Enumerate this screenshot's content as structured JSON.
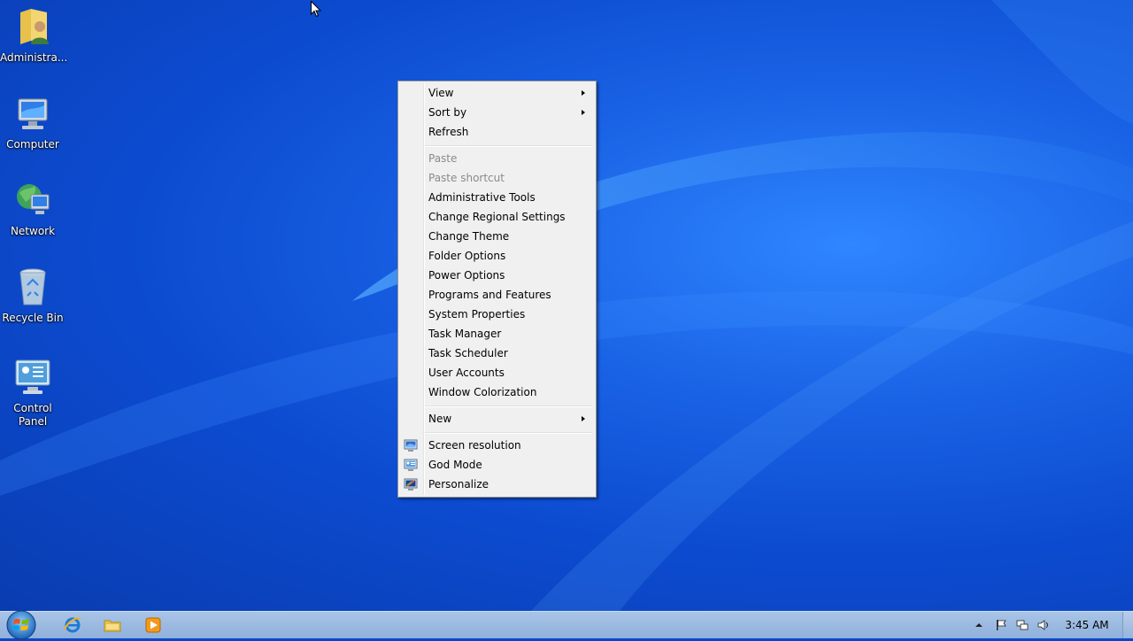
{
  "desktop": {
    "icons": [
      {
        "label": "Administra...",
        "icon": "user-folder-icon"
      },
      {
        "label": "Computer",
        "icon": "computer-icon"
      },
      {
        "label": "Network",
        "icon": "network-icon"
      },
      {
        "label": "Recycle Bin",
        "icon": "recycle-bin-icon"
      },
      {
        "label": "Control Panel",
        "icon": "control-panel-icon"
      }
    ]
  },
  "context_menu": {
    "items": [
      {
        "label": "View",
        "submenu": true,
        "enabled": true
      },
      {
        "label": "Sort by",
        "submenu": true,
        "enabled": true
      },
      {
        "label": "Refresh",
        "enabled": true
      },
      {
        "label": "Paste",
        "enabled": false
      },
      {
        "label": "Paste shortcut",
        "enabled": false
      },
      {
        "label": "Administrative Tools",
        "enabled": true
      },
      {
        "label": "Change Regional Settings",
        "enabled": true
      },
      {
        "label": "Change Theme",
        "enabled": true
      },
      {
        "label": "Folder Options",
        "enabled": true
      },
      {
        "label": "Power Options",
        "enabled": true
      },
      {
        "label": "Programs and Features",
        "enabled": true
      },
      {
        "label": "System Properties",
        "enabled": true
      },
      {
        "label": "Task Manager",
        "enabled": true
      },
      {
        "label": "Task Scheduler",
        "enabled": true
      },
      {
        "label": "User Accounts",
        "enabled": true
      },
      {
        "label": "Window Colorization",
        "enabled": true
      },
      {
        "label": "New",
        "submenu": true,
        "enabled": true
      },
      {
        "label": "Screen resolution",
        "icon": "screen-resolution-icon",
        "enabled": true
      },
      {
        "label": "God Mode",
        "icon": "god-mode-icon",
        "enabled": true
      },
      {
        "label": "Personalize",
        "icon": "personalize-icon",
        "enabled": true
      }
    ]
  },
  "taskbar": {
    "start": "start-orb-icon",
    "pinned": [
      {
        "name": "Internet Explorer",
        "icon": "internet-explorer-icon"
      },
      {
        "name": "Windows Explorer",
        "icon": "folder-icon"
      },
      {
        "name": "Windows Media Player",
        "icon": "media-player-icon"
      }
    ],
    "tray": {
      "icons": [
        "show-hidden-icons-icon",
        "action-center-flag-icon",
        "network-tray-icon",
        "volume-icon"
      ],
      "clock": "3:45 AM"
    }
  },
  "colors": {
    "desktop_bg": "#0c4bd0",
    "menu_bg": "#f0f0f0",
    "taskbar_bg": "#9fbde3"
  }
}
